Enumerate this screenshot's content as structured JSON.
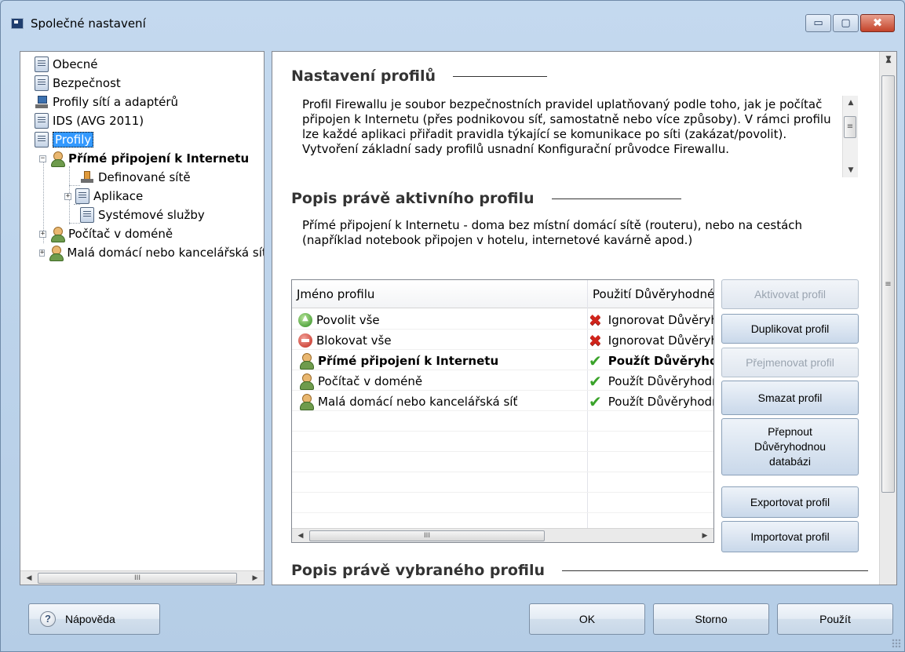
{
  "window": {
    "title": "Společné nastavení",
    "caption": {
      "minimize": "▭",
      "maximize": "▢",
      "close": "✖"
    }
  },
  "tree": {
    "items": [
      {
        "label": "Obecné",
        "icon": "document-icon"
      },
      {
        "label": "Bezpečnost",
        "icon": "document-icon"
      },
      {
        "label": "Profily sítí a adaptérů",
        "icon": "network-icon"
      },
      {
        "label": "IDS (AVG 2011)",
        "icon": "document-icon"
      },
      {
        "label": "Profily",
        "icon": "document-icon",
        "selected": true
      },
      {
        "label": "Přímé připojení k Internetu",
        "icon": "user-icon",
        "bold": true,
        "expander": "−"
      },
      {
        "label": "Definované sítě",
        "icon": "network-icon"
      },
      {
        "label": "Aplikace",
        "icon": "document-icon",
        "expander": "+"
      },
      {
        "label": "Systémové služby",
        "icon": "document-icon"
      },
      {
        "label": "Počítač v doméně",
        "icon": "user-icon",
        "expander": "+"
      },
      {
        "label": "Malá domácí nebo kancelářská síť",
        "icon": "user-icon",
        "expander": "+"
      }
    ],
    "scroll_thumb_glyph": "III"
  },
  "main": {
    "section1_title": "Nastavení profilů",
    "section1_text": "Profil Firewallu je soubor bezpečnostních pravidel uplatňovaný podle toho, jak je počítač připojen k Internetu (přes podnikovou síť, samostatně nebo více způsoby). V rámci profilu lze každé aplikaci přiřadit pravidla týkající se komunikace po síti (zakázat/povolit). Vytvoření základní sady profilů usnadní Konfigurační průvodce Firewallu.",
    "section2_title": "Popis právě aktivního profilu",
    "section2_text": "Přímé připojení k Internetu - doma bez místní domácí sítě (routeru), nebo na cestách (například notebook připojen v hotelu, internetové kavárně apod.)",
    "section3_title": "Popis právě vybraného profilu",
    "list": {
      "columns": [
        "Jméno profilu",
        "Použití Důvěryhodné databáze"
      ],
      "rows": [
        {
          "name": "Povolit vše",
          "icon": "allow-icon",
          "status_icon": "cross-icon",
          "usage": "Ignorovat Důvěryhodnou databázi",
          "bold": false
        },
        {
          "name": "Blokovat vše",
          "icon": "block-icon",
          "status_icon": "cross-icon",
          "usage": "Ignorovat Důvěryhodnou databázi",
          "bold": false
        },
        {
          "name": "Přímé připojení k Internetu",
          "icon": "user-icon",
          "status_icon": "check-icon",
          "usage": "Použít Důvěryhodnou databázi",
          "bold": true
        },
        {
          "name": "Počítač v doméně",
          "icon": "user-icon",
          "status_icon": "check-icon",
          "usage": "Použít Důvěryhodnou databázi",
          "bold": false
        },
        {
          "name": "Malá domácí nebo kancelářská síť",
          "icon": "user-icon",
          "status_icon": "check-icon",
          "usage": "Použít Důvěryhodnou databázi",
          "bold": false
        }
      ],
      "scroll_thumb_glyph": "III"
    },
    "buttons": {
      "activate": "Aktivovat profil",
      "duplicate": "Duplikovat profil",
      "rename": "Přejmenovat profil",
      "delete": "Smazat profil",
      "toggle_db": "Přepnout Důvěryhodnou databázi",
      "export": "Exportovat profil",
      "import": "Importovat profil"
    }
  },
  "footer": {
    "help": "Nápověda",
    "ok": "OK",
    "cancel": "Storno",
    "apply": "Použít"
  },
  "colors": {
    "selection": "#3399ff",
    "title_bar": "#c4d9ef",
    "close_button": "#c4432a"
  }
}
